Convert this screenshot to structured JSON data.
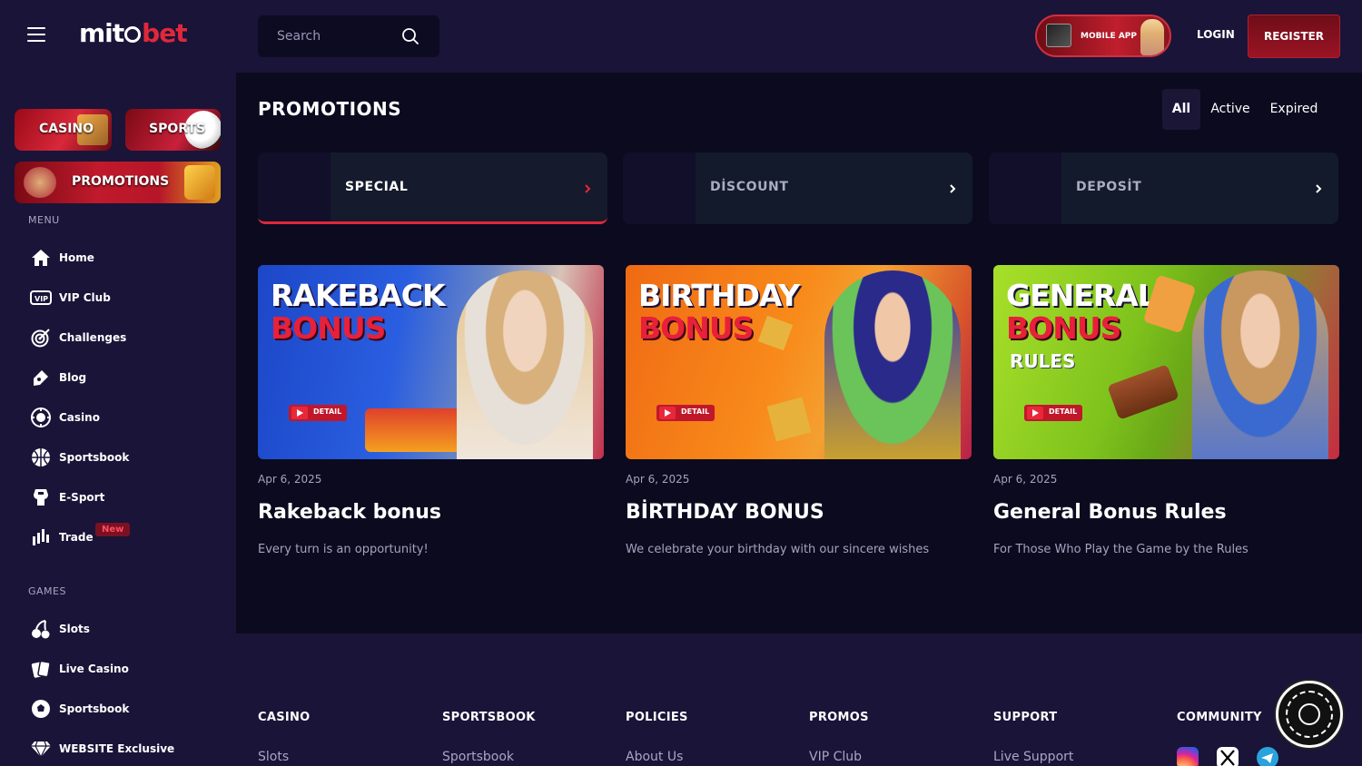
{
  "header": {
    "logo_part1": "mit",
    "logo_part2": "bet",
    "search_placeholder": "Search",
    "mobile_app_label": "MOBILE APP",
    "login_label": "LOGIN",
    "register_label": "REGISTER"
  },
  "sidebar": {
    "tiles": {
      "casino": "CASINO",
      "sports": "SPORTS",
      "promotions": "PROMOTIONS"
    },
    "menu_title": "MENU",
    "menu": [
      {
        "label": "Home",
        "icon": "home-icon"
      },
      {
        "label": "VIP Club",
        "icon": "vip-icon"
      },
      {
        "label": "Challenges",
        "icon": "target-icon"
      },
      {
        "label": "Blog",
        "icon": "blog-icon"
      },
      {
        "label": "Casino",
        "icon": "casino-chip-icon"
      },
      {
        "label": "Sportsbook",
        "icon": "basketball-icon"
      },
      {
        "label": "E-Sport",
        "icon": "esport-icon"
      },
      {
        "label": "Trade",
        "icon": "trade-chart-icon"
      }
    ],
    "new_badge": "New",
    "games_title": "GAMES",
    "games": [
      {
        "label": "Slots",
        "icon": "cherry-icon"
      },
      {
        "label": "Live Casino",
        "icon": "cards-icon"
      },
      {
        "label": "Sportsbook",
        "icon": "soccer-ball-icon"
      },
      {
        "label": "WEBSITE Exclusive",
        "icon": "diamond-icon"
      }
    ]
  },
  "main": {
    "title": "PROMOTIONS",
    "filters": {
      "all": "All",
      "active": "Active",
      "expired": "Expired"
    },
    "categories": [
      {
        "label": "SPECIAL",
        "active": true
      },
      {
        "label": "DİSCOUNT",
        "active": false
      },
      {
        "label": "DEPOSİT",
        "active": false
      }
    ],
    "promos": [
      {
        "banner_line1": "RAKEBACK",
        "banner_line2": "BONUS",
        "banner_line3": "",
        "detail": "DETAIL",
        "date": "Apr 6, 2025",
        "title": "Rakeback bonus",
        "desc": "Every turn is an opportunity!"
      },
      {
        "banner_line1": "BIRTHDAY",
        "banner_line2": "BONUS",
        "banner_line3": "",
        "detail": "DETAIL",
        "date": "Apr 6, 2025",
        "title": "BİRTHDAY BONUS",
        "desc": "We celebrate your birthday with our sincere wishes"
      },
      {
        "banner_line1": "GENERAL",
        "banner_line2": "BONUS",
        "banner_line3": "RULES",
        "detail": "DETAIL",
        "date": "Apr 6, 2025",
        "title": "General Bonus Rules",
        "desc": "For Those Who Play the Game by the Rules"
      }
    ]
  },
  "footer": {
    "columns": [
      {
        "heading": "CASINO",
        "first_link": "Slots"
      },
      {
        "heading": "SPORTSBOOK",
        "first_link": "Sportsbook"
      },
      {
        "heading": "POLICIES",
        "first_link": "About Us"
      },
      {
        "heading": "PROMOS",
        "first_link": "VIP Club"
      },
      {
        "heading": "SUPPORT",
        "first_link": "Live Support"
      },
      {
        "heading": "COMMUNITY",
        "first_link": ""
      }
    ],
    "social": [
      "instagram-icon",
      "x-icon",
      "telegram-icon"
    ]
  },
  "colors": {
    "accent": "#e0283a",
    "sidebar_bg": "#1a1438",
    "main_bg": "#0b0a1f",
    "muted_text": "#a9a6c2"
  }
}
